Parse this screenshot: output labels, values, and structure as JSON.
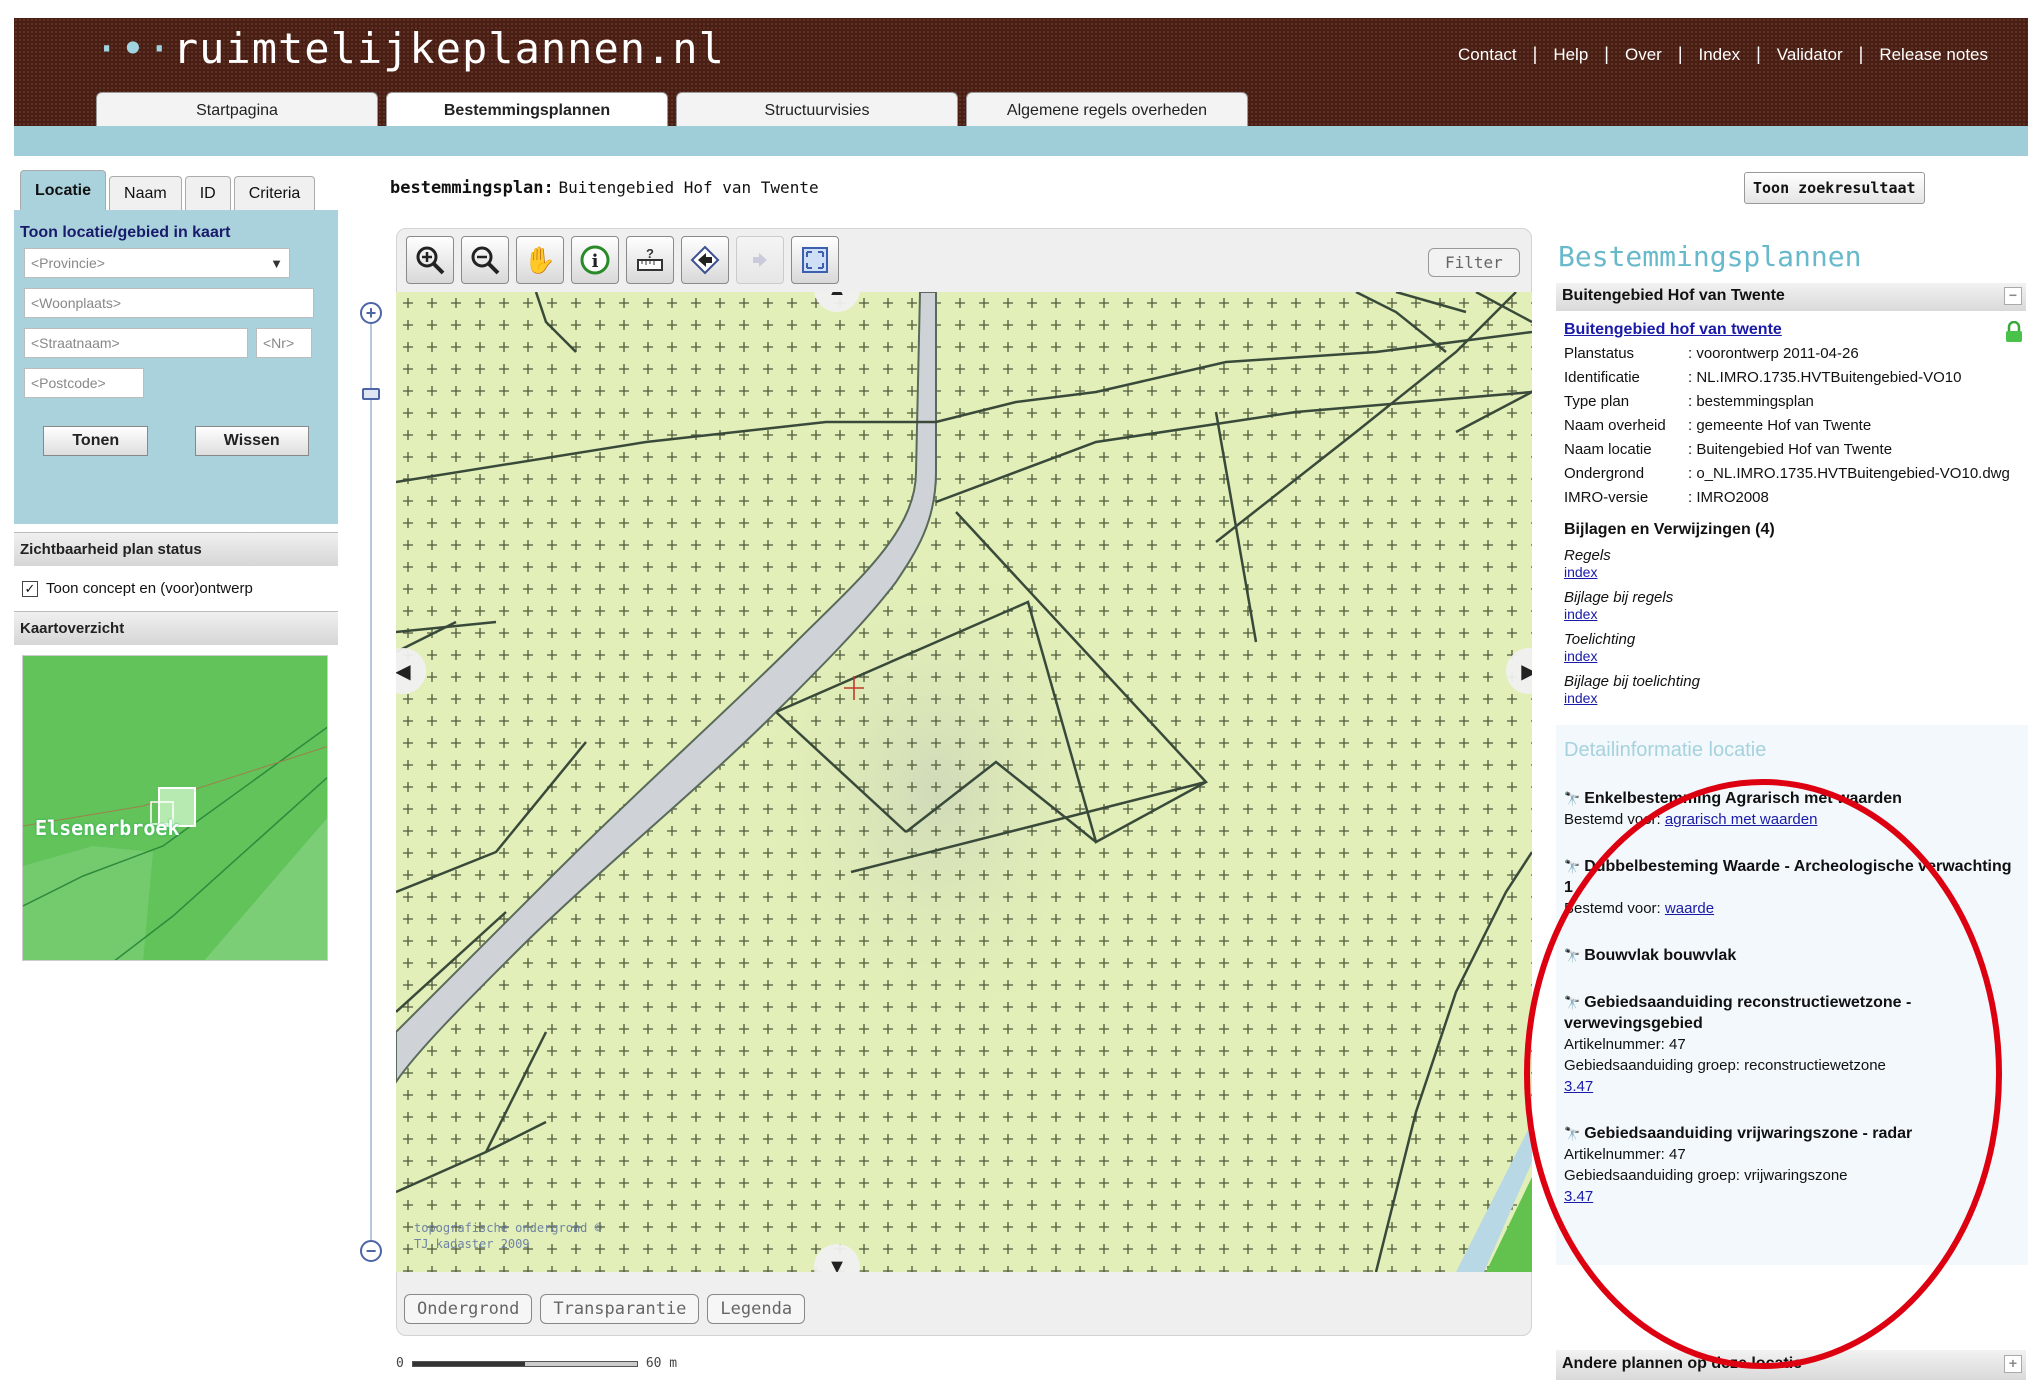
{
  "header": {
    "logo": "ruimtelijkeplannen.nl",
    "links": [
      "Contact",
      "Help",
      "Over",
      "Index",
      "Validator",
      "Release notes"
    ],
    "tabs": [
      {
        "label": "Startpagina",
        "active": false
      },
      {
        "label": "Bestemmingsplannen",
        "active": true
      },
      {
        "label": "Structuurvisies",
        "active": false
      },
      {
        "label": "Algemene regels overheden",
        "active": false
      }
    ]
  },
  "left": {
    "tabs": [
      "Locatie",
      "Naam",
      "ID",
      "Criteria"
    ],
    "locatie_title": "Toon locatie/gebied in kaart",
    "provincie_placeholder": "<Provincie>",
    "woonplaats_placeholder": "<Woonplaats>",
    "straatnaam_placeholder": "<Straatnaam>",
    "nr_placeholder": "<Nr>",
    "postcode_placeholder": "<Postcode>",
    "tonen_label": "Tonen",
    "wissen_label": "Wissen",
    "zicht_title": "Zichtbaarheid plan status",
    "zicht_checkbox_label": "Toon concept en (voor)ontwerp",
    "zicht_checked": true,
    "overzicht_title": "Kaartoverzicht",
    "overzicht_place": "Elsenerbroek"
  },
  "center": {
    "plan_label": "bestemmingsplan:",
    "plan_name": "Buitengebied Hof van Twente",
    "toon_zoekresultaat": "Toon zoekresultaat",
    "filter_label": "Filter",
    "tools": [
      "zoom-in-icon",
      "zoom-out-icon",
      "pan-hand-icon",
      "info-icon",
      "measure-icon",
      "back-icon",
      "forward-icon",
      "full-extent-icon"
    ],
    "copyright_line1": "topografische ondergrond ©",
    "copyright_line2": "TJ kadaster 2009",
    "bottom_buttons": [
      "Ondergrond",
      "Transparantie",
      "Legenda"
    ],
    "scale_start": "0",
    "scale_end": "60 m"
  },
  "right": {
    "title": "Bestemmingsplannen",
    "plan_header": "Buitengebied Hof van Twente",
    "plan_link": "Buitengebied hof van twente",
    "fields": [
      {
        "k": "Planstatus",
        "v": ": voorontwerp 2011-04-26"
      },
      {
        "k": "Identificatie",
        "v": ": NL.IMRO.1735.HVTBuitengebied-VO10"
      },
      {
        "k": "Type plan",
        "v": ": bestemmingsplan"
      },
      {
        "k": "Naam overheid",
        "v": ": gemeente Hof van Twente"
      },
      {
        "k": "Naam locatie",
        "v": ": Buitengebied Hof van Twente"
      },
      {
        "k": "Ondergrond",
        "v": ": o_NL.IMRO.1735.HVTBuitengebied-VO10.dwg"
      },
      {
        "k": "IMRO-versie",
        "v": ": IMRO2008"
      }
    ],
    "bijlagen_title": "Bijlagen en Verwijzingen (4)",
    "bijlagen": [
      {
        "name": "Regels",
        "link": "index"
      },
      {
        "name": "Bijlage bij regels",
        "link": "index"
      },
      {
        "name": "Toelichting",
        "link": "index"
      },
      {
        "name": "Bijlage bij toelichting",
        "link": "index"
      }
    ],
    "detail_title": "Detailinformatie locatie",
    "details": [
      {
        "title": "Enkelbestemming Agrarisch met waarden",
        "lines": [],
        "bestemd_label": "Bestemd voor:",
        "bestemd_link": "agrarisch met waarden"
      },
      {
        "title": "Dubbelbesteming Waarde - Archeologische verwachting 1",
        "lines": [],
        "bestemd_label": "Bestemd voor:",
        "bestemd_link": "waarde"
      },
      {
        "title": "Bouwvlak bouwvlak",
        "lines": [],
        "bestemd_label": "",
        "bestemd_link": ""
      },
      {
        "title": "Gebiedsaanduiding reconstructiewetzone - verwevingsgebied",
        "lines": [
          "Artikelnummer: 47",
          "Gebiedsaanduiding groep: reconstructiewetzone"
        ],
        "bestemd_label": "",
        "bestemd_link": "3.47"
      },
      {
        "title": "Gebiedsaanduiding vrijwaringszone - radar",
        "lines": [
          "Artikelnummer: 47",
          "Gebiedsaanduiding groep: vrijwaringszone"
        ],
        "bestemd_label": "",
        "bestemd_link": "3.47"
      }
    ],
    "andere_title": "Andere plannen op deze locatie"
  },
  "colors": {
    "header_bg": "#4a1e12",
    "band": "#9fcdd8",
    "map_bg": "#e2efb8",
    "road": "#cfd3d8",
    "water": "#b9d8e6",
    "green": "#63c24e",
    "annotation": "#dd0010"
  }
}
